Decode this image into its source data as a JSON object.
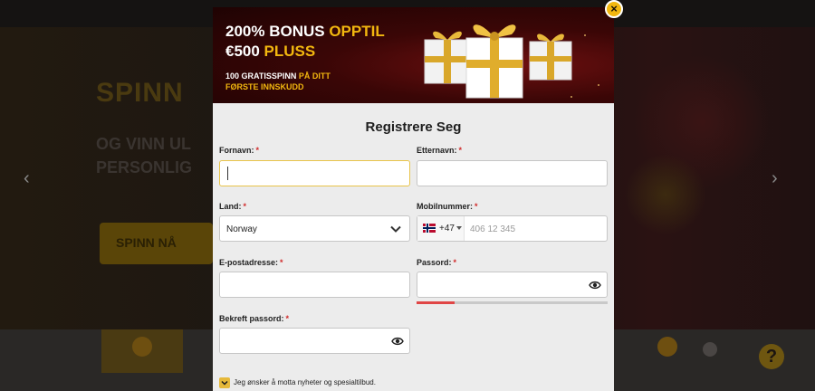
{
  "background": {
    "hero_title": "SPINN",
    "hero_subtitle_line1": "OG VINN UL",
    "hero_subtitle_line2": "PERSONLIG",
    "hero_cta": "SPINN NÅ"
  },
  "banner": {
    "headline_white_1": "200% BONUS ",
    "headline_gold_1": "OPPTIL",
    "headline_white_2": "€500 ",
    "headline_gold_2": "PLUSS",
    "sub_white": "100 GRATISSPINN ",
    "sub_gold_1": "PÅ DITT",
    "sub_gold_2": "FØRSTE INNSKUDD"
  },
  "close_label": "×",
  "form": {
    "title": "Registrere Seg",
    "required_marker": "*",
    "fields": {
      "first_name": {
        "label": "Fornavn:",
        "value": ""
      },
      "last_name": {
        "label": "Etternavn:",
        "value": ""
      },
      "country": {
        "label": "Land:",
        "value": "Norway"
      },
      "mobile": {
        "label": "Mobilnummer:",
        "country_code": "+47",
        "placeholder": "406 12 345"
      },
      "email": {
        "label": "E-postadresse:",
        "value": ""
      },
      "password": {
        "label": "Passord:",
        "value": "",
        "strength": 0.2
      },
      "confirm_password": {
        "label": "Bekreft passord:",
        "value": ""
      }
    },
    "newsletter": {
      "label": "Jeg ønsker å motta nyheter og spesialtilbud.",
      "checked": true
    }
  },
  "help_label": "?",
  "colors": {
    "accent_gold": "#f2b70f",
    "required_red": "#d12b2b",
    "strength_red": "#e04646",
    "banner_red": "#6e1010"
  },
  "icons": [
    "close-icon",
    "chevron-down-icon",
    "eye-icon",
    "check-icon",
    "norway-flag-icon",
    "gift-icon",
    "arrow-left-icon",
    "arrow-right-icon",
    "help-icon"
  ]
}
